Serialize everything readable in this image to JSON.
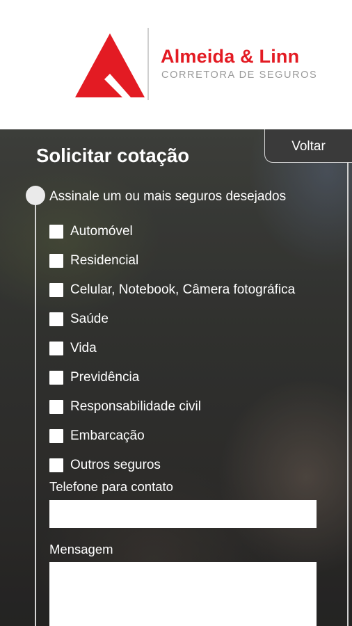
{
  "brand": {
    "name": "Almeida & Linn",
    "tagline": "CORRETORA DE SEGUROS",
    "color": "#e31b23"
  },
  "page": {
    "title": "Solicitar cotação",
    "back_label": "Voltar"
  },
  "form": {
    "instruction": "Assinale um ou mais seguros desejados",
    "options": [
      {
        "label": "Automóvel",
        "checked": false
      },
      {
        "label": "Residencial",
        "checked": false
      },
      {
        "label": "Celular, Notebook, Câmera fotográfica",
        "checked": false
      },
      {
        "label": "Saúde",
        "checked": false
      },
      {
        "label": "Vida",
        "checked": false
      },
      {
        "label": "Previdência",
        "checked": false
      },
      {
        "label": "Responsabilidade civil",
        "checked": false
      },
      {
        "label": "Embarcação",
        "checked": false
      },
      {
        "label": "Outros seguros",
        "checked": false
      }
    ],
    "phone_label": "Telefone para contato",
    "phone_value": "",
    "message_label": "Mensagem",
    "message_value": ""
  }
}
